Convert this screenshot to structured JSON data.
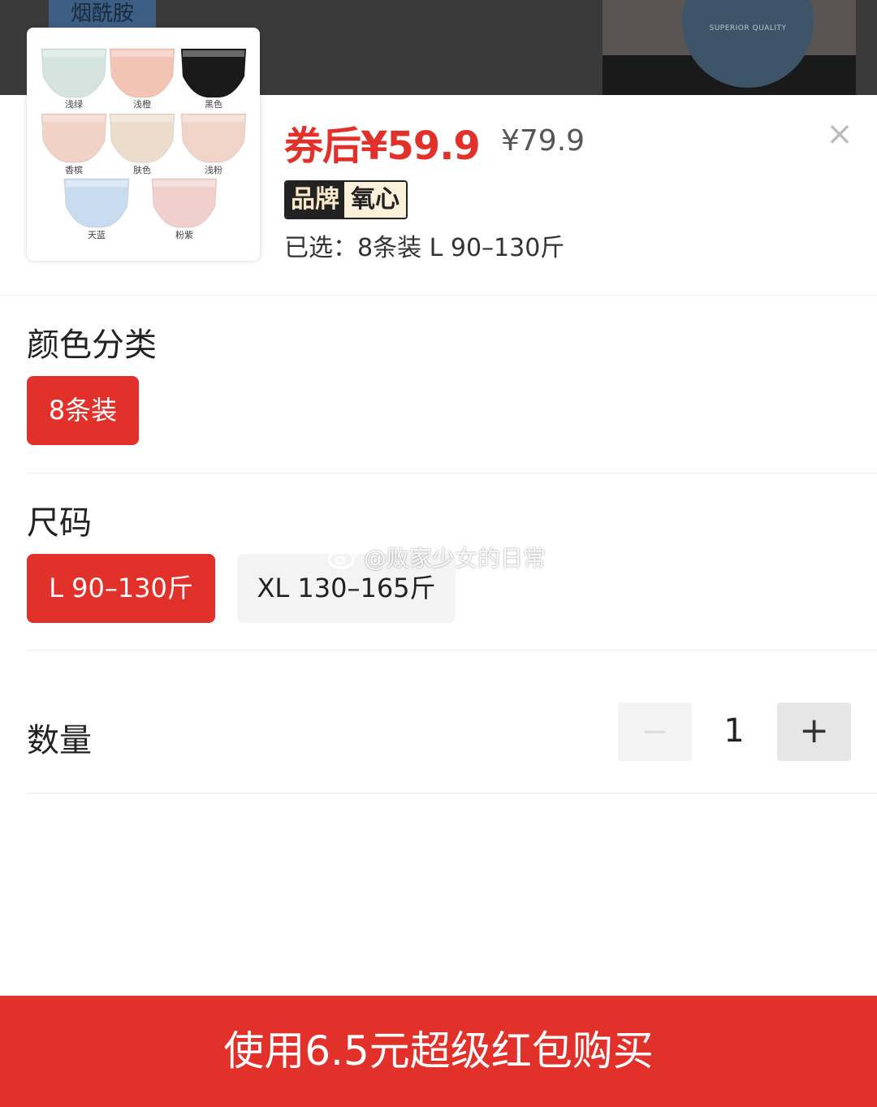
{
  "backdrop": {
    "tag_text": "烟酰胺",
    "badge_text": "SUPERIOR QUALITY"
  },
  "product": {
    "thumbnail_swatches": [
      {
        "label": "浅绿",
        "color": "#d4e3dd"
      },
      {
        "label": "浅橙",
        "color": "#f2c4b4"
      },
      {
        "label": "黑色",
        "color": "#1a1a1a"
      },
      {
        "label": "香槟",
        "color": "#f1d2c6"
      },
      {
        "label": "肤色",
        "color": "#ecdccc"
      },
      {
        "label": "浅粉",
        "color": "#f0d4c8"
      },
      {
        "label": "天蓝",
        "color": "#c9dcef"
      },
      {
        "label": "粉紫",
        "color": "#f0cfcc"
      }
    ],
    "sale_price": "券后¥59.9",
    "original_price": "¥79.9",
    "brand_label": "品牌",
    "brand_name": "氧心",
    "selected_summary": "已选：8条装 L 90–130斤",
    "close_icon": "×"
  },
  "color_section": {
    "title": "颜色分类",
    "options": [
      {
        "label": "8条装",
        "selected": true
      }
    ]
  },
  "size_section": {
    "title": "尺码",
    "options": [
      {
        "label": "L 90–130斤",
        "selected": true
      },
      {
        "label": "XL 130–165斤",
        "selected": false
      }
    ]
  },
  "quantity_section": {
    "title": "数量",
    "minus_icon": "−",
    "value": "1",
    "plus_icon": "+"
  },
  "watermark": {
    "text": "@败家少女的日常"
  },
  "buy_button": {
    "label": "使用6.5元超级红包购买"
  },
  "colors": {
    "accent": "#e2312a",
    "chip_inactive": "#f3f3f3"
  }
}
